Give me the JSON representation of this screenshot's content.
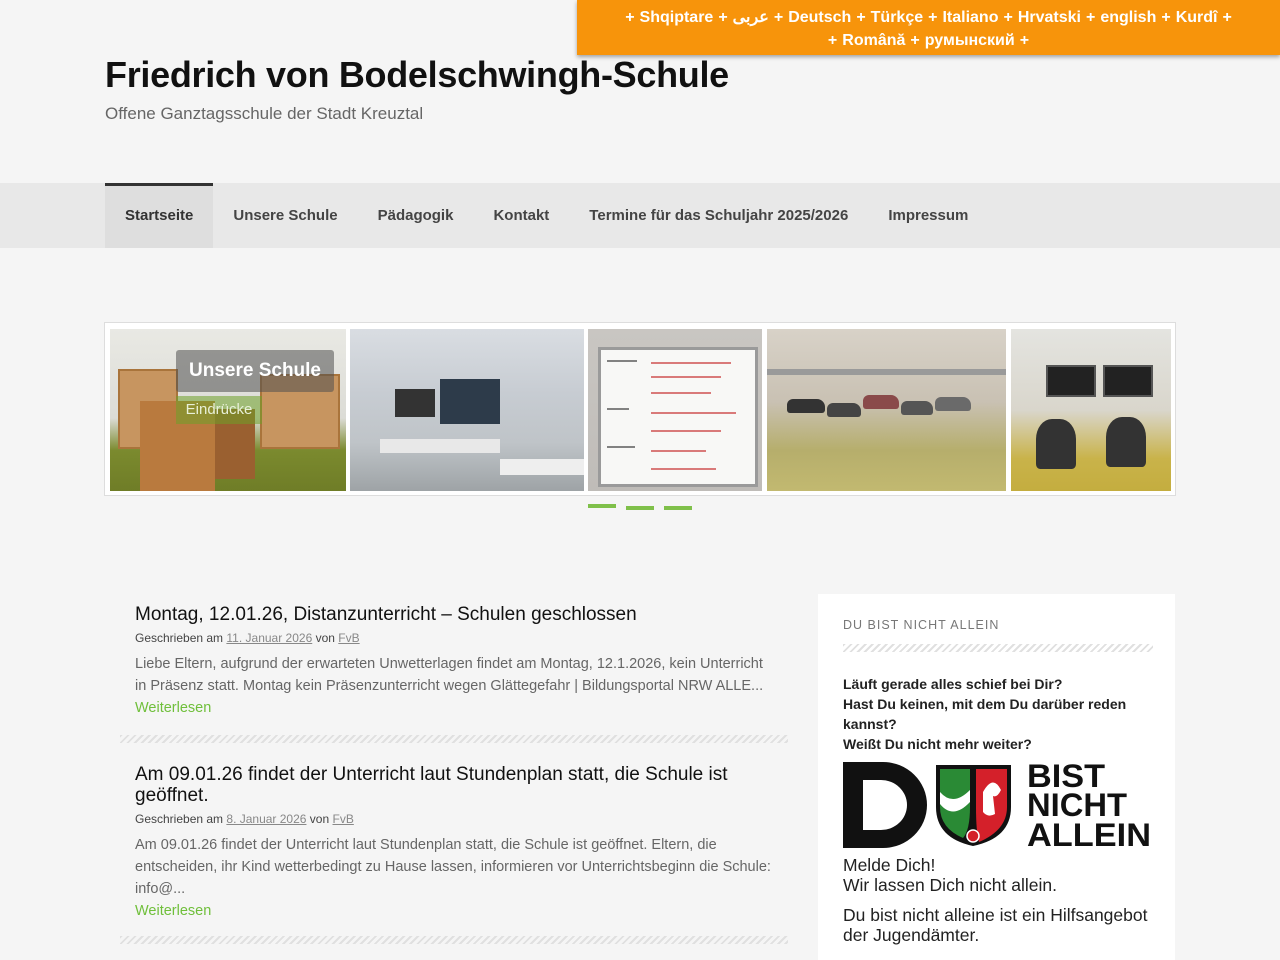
{
  "language_bar": {
    "line1": [
      "Shqiptare",
      "عربى",
      "Deutsch",
      "Türkçe",
      "Italiano",
      "Hrvatski",
      "english",
      "Kurdî"
    ],
    "line2": [
      "Română",
      "румынский"
    ]
  },
  "header": {
    "title": "Friedrich von Bodelschwingh-Schule",
    "description": "Offene Ganztagsschule der Stadt Kreuztal"
  },
  "nav": {
    "items": [
      {
        "label": "Startseite",
        "active": true
      },
      {
        "label": "Unsere Schule"
      },
      {
        "label": "Pädagogik"
      },
      {
        "label": "Kontakt"
      },
      {
        "label": "Termine für das Schuljahr 2025/2026"
      },
      {
        "label": "Impressum"
      }
    ]
  },
  "slider": {
    "caption_title": "Unsere Schule",
    "caption_sub": "Eindrücke",
    "dots": 3,
    "accent": "#7fc04a"
  },
  "posts": [
    {
      "title": "Montag, 12.01.26, Distanzunterricht – Schulen geschlossen",
      "meta_prefix": "Geschrieben am",
      "date": "11. Januar 2026",
      "by": "von",
      "author": "FvB",
      "excerpt": "Liebe Eltern,  aufgrund der erwarteten Unwetterlagen findet am Montag, 12.1.2026, kein Unterricht in Präsenz statt.  Montag kein Präsenzunterricht wegen Glättegefahr | Bildungsportal NRW ALLE...",
      "read_more": "Weiterlesen"
    },
    {
      "title": "Am 09.01.26 findet der Unterricht laut Stundenplan statt, die Schule ist geöffnet.",
      "meta_prefix": "Geschrieben am",
      "date": "8. Januar 2026",
      "by": "von",
      "author": "FvB",
      "excerpt": "Am 09.01.26 findet der Unterricht laut Stundenplan statt, die Schule ist geöffnet. Eltern, die entscheiden, ihr Kind wetterbedingt zu Hause lassen, informieren vor Unterrichtsbeginn die Schule: info@...",
      "read_more": "Weiterlesen"
    }
  ],
  "sidebar": {
    "widget_title": "DU BIST NICHT ALLEIN",
    "question1": "Läuft gerade alles schief bei Dir?",
    "question2": "Hast Du keinen, mit dem Du darüber reden kannst?",
    "question3": "Weißt Du nicht mehr weiter?",
    "logo_text": [
      "BIST",
      "NICHT",
      "ALLEIN"
    ],
    "text1a": "Melde Dich!",
    "text1b": "Wir lassen Dich nicht allein.",
    "text2": "Du bist nicht alleine ist ein Hilfsangebot der Jugendämter."
  },
  "colors": {
    "language_bar": "#f7940b",
    "link_green": "#6fbf3a"
  }
}
